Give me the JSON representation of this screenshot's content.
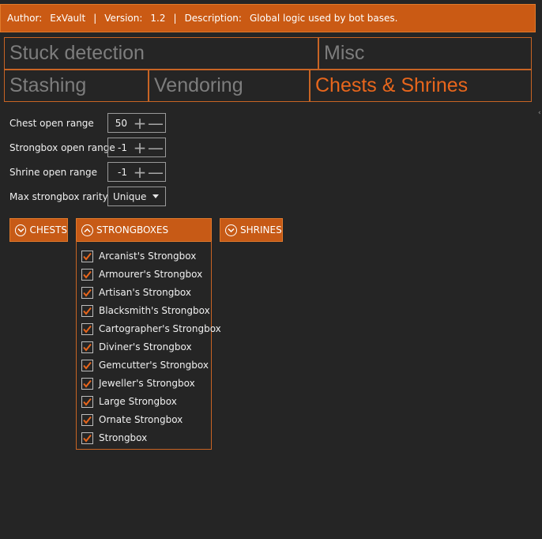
{
  "header": {
    "author_label": "Author:",
    "author": "ExVault",
    "separator": "|",
    "version_label": "Version:",
    "version": "1.2",
    "description_label": "Description:",
    "description": "Global logic used by bot bases."
  },
  "tabs": [
    {
      "label": "Stuck detection"
    },
    {
      "label": "Misc"
    },
    {
      "label": "Stashing"
    },
    {
      "label": "Vendoring"
    },
    {
      "label": "Chests & Shrines",
      "active": true
    }
  ],
  "settings": {
    "chest_open_range": {
      "label": "Chest open range",
      "value": "50"
    },
    "strongbox_open_range": {
      "label": "Strongbox open range",
      "value": "-1"
    },
    "shrine_open_range": {
      "label": "Shrine open range",
      "value": "-1"
    },
    "max_strongbox_rarity": {
      "label": "Max strongbox rarity",
      "value": "Unique"
    }
  },
  "expanders": {
    "chests": "CHESTS",
    "strongboxes": "STRONGBOXES",
    "shrines": "SHRINES"
  },
  "strongboxes": [
    "Arcanist's Strongbox",
    "Armourer's Strongbox",
    "Artisan's Strongbox",
    "Blacksmith's Strongbox",
    "Cartographer's Strongbox",
    "Diviner's Strongbox",
    "Gemcutter's Strongbox",
    "Jeweller's Strongbox",
    "Large Strongbox",
    "Ornate Strongbox",
    "Strongbox"
  ],
  "colors": {
    "accent": "#c75a16",
    "active_tab_text": "#e8661c",
    "background": "#252525"
  }
}
